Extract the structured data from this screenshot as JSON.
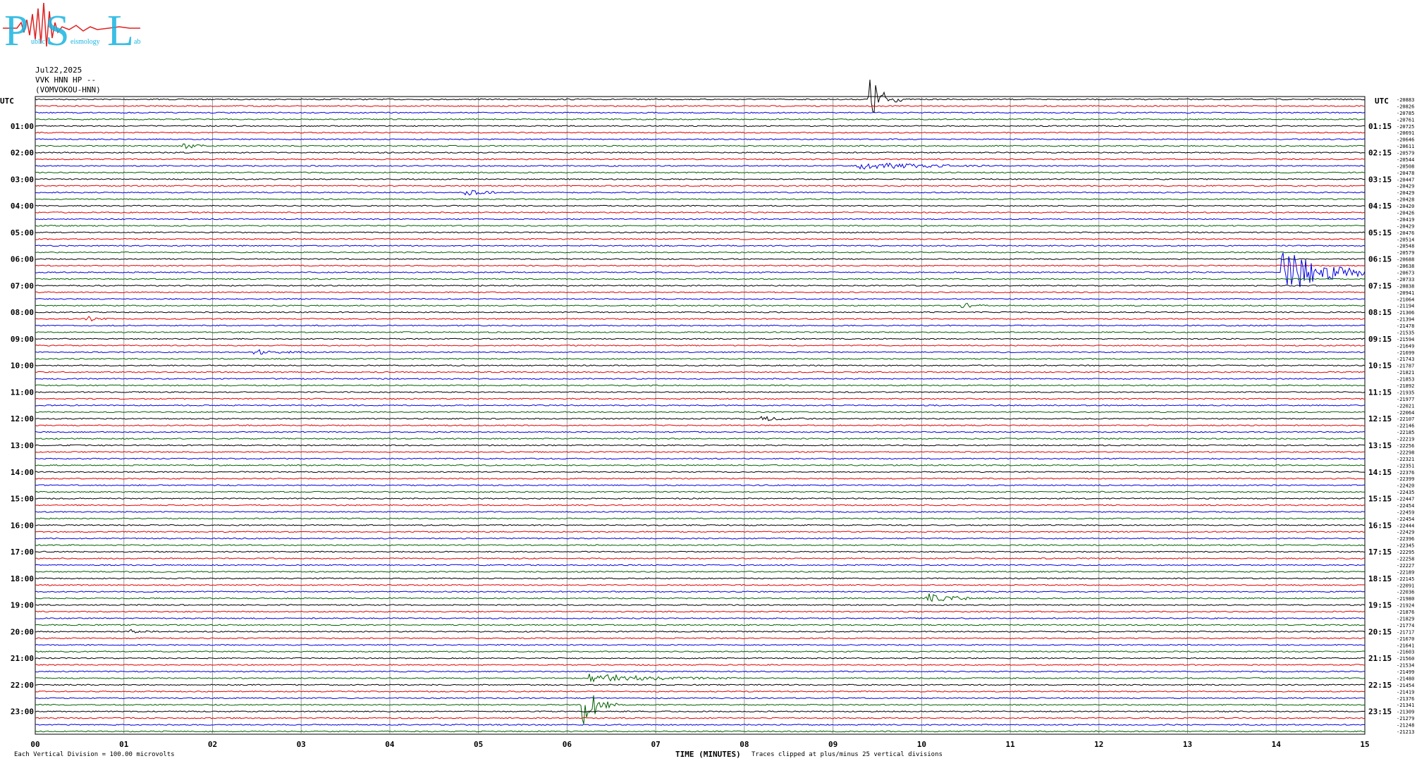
{
  "logo": {
    "letters": [
      "P",
      "S",
      "L"
    ],
    "word_fragments": [
      "ublic",
      "eismology",
      "ab"
    ],
    "colors": {
      "letters": "#19b5e0",
      "waveform": "#e02020"
    }
  },
  "header": {
    "date": "Jul22,2025",
    "channel": "VVK HNN HP --",
    "station": "(VOMVOKOU-HNN)"
  },
  "left_axis_title": "UTC",
  "right_axis_title": "UTC",
  "footer": {
    "scale_note": "Each Vertical Division =  100.00 microvolts",
    "x_title": "TIME (MINUTES)",
    "clip_note": "Traces clipped at plus/minus 25 vertical divisions"
  },
  "chart_data": {
    "type": "line",
    "title": "",
    "xlabel": "TIME (MINUTES)",
    "ylabel": "UTC",
    "xlim": [
      0,
      15
    ],
    "x_ticks": [
      "00",
      "01",
      "02",
      "03",
      "04",
      "05",
      "06",
      "07",
      "08",
      "09",
      "10",
      "11",
      "12",
      "13",
      "14",
      "15"
    ],
    "left_tick_labels": [
      "01:00",
      "02:00",
      "03:00",
      "04:00",
      "05:00",
      "06:00",
      "07:00",
      "08:00",
      "09:00",
      "10:00",
      "11:00",
      "12:00",
      "13:00",
      "14:00",
      "15:00",
      "16:00",
      "17:00",
      "18:00",
      "19:00",
      "20:00",
      "21:00",
      "22:00",
      "23:00"
    ],
    "right_tick_labels": [
      "01:15",
      "02:15",
      "03:15",
      "04:15",
      "05:15",
      "06:15",
      "07:15",
      "08:15",
      "09:15",
      "10:15",
      "11:15",
      "12:15",
      "13:15",
      "14:15",
      "15:15",
      "16:15",
      "17:15",
      "18:15",
      "19:15",
      "20:15",
      "21:15",
      "22:15",
      "23:15"
    ],
    "trace_colors": [
      "#000000",
      "#e00000",
      "#0000e0",
      "#006000"
    ],
    "trace_count": 96,
    "row_offsets": [
      -20883,
      -20826,
      -20785,
      -20761,
      -20725,
      -20691,
      -20646,
      -20611,
      -20579,
      -20544,
      -20508,
      -20478,
      -20447,
      -20429,
      -20429,
      -20428,
      -20420,
      -20426,
      -20419,
      -20429,
      -20476,
      -20514,
      -20548,
      -20579,
      -20688,
      -20638,
      -20673,
      -20733,
      -20838,
      -20941,
      -21064,
      -21194,
      -21306,
      -21394,
      -21478,
      -21535,
      -21594,
      -21649,
      -21699,
      -21743,
      -21787,
      -21821,
      -21853,
      -21892,
      -21935,
      -21977,
      -22021,
      -22064,
      -22107,
      -22146,
      -22185,
      -22219,
      -22256,
      -22298,
      -22321,
      -22351,
      -22376,
      -22399,
      -22420,
      -22435,
      -22447,
      -22454,
      -22459,
      -22454,
      -22444,
      -22429,
      -22396,
      -22345,
      -22295,
      -22258,
      -22227,
      -22189,
      -22145,
      -22091,
      -22036,
      -21980,
      -21924,
      -21876,
      -21829,
      -21774,
      -21717,
      -21670,
      -21641,
      -21603,
      -21560,
      -21534,
      -21499,
      -21480,
      -21454,
      -21419,
      -21376,
      -21341,
      -21309,
      -21279,
      -21248,
      -21213
    ],
    "events": [
      {
        "row": 0,
        "minute": 9.45,
        "amplitude": "large",
        "duration_min": 0.35
      },
      {
        "row": 26,
        "minute": 14.1,
        "amplitude": "large",
        "duration_min": 1.3
      },
      {
        "row": 91,
        "minute": 6.2,
        "amplitude": "large",
        "duration_min": 0.4
      },
      {
        "row": 87,
        "minute": 6.3,
        "amplitude": "medium",
        "duration_min": 1.6
      },
      {
        "row": 10,
        "minute": 9.3,
        "amplitude": "medium",
        "duration_min": 1.6
      },
      {
        "row": 75,
        "minute": 10.1,
        "amplitude": "medium",
        "duration_min": 0.8
      },
      {
        "row": 7,
        "minute": 1.7,
        "amplitude": "small",
        "duration_min": 0.4
      },
      {
        "row": 14,
        "minute": 4.9,
        "amplitude": "small",
        "duration_min": 0.5
      },
      {
        "row": 31,
        "minute": 10.5,
        "amplitude": "small",
        "duration_min": 0.3
      },
      {
        "row": 33,
        "minute": 0.6,
        "amplitude": "small",
        "duration_min": 0.3
      },
      {
        "row": 48,
        "minute": 8.2,
        "amplitude": "small",
        "duration_min": 0.6
      },
      {
        "row": 80,
        "minute": 1.1,
        "amplitude": "small",
        "duration_min": 0.3
      },
      {
        "row": 38,
        "minute": 2.5,
        "amplitude": "small",
        "duration_min": 0.8
      }
    ]
  }
}
